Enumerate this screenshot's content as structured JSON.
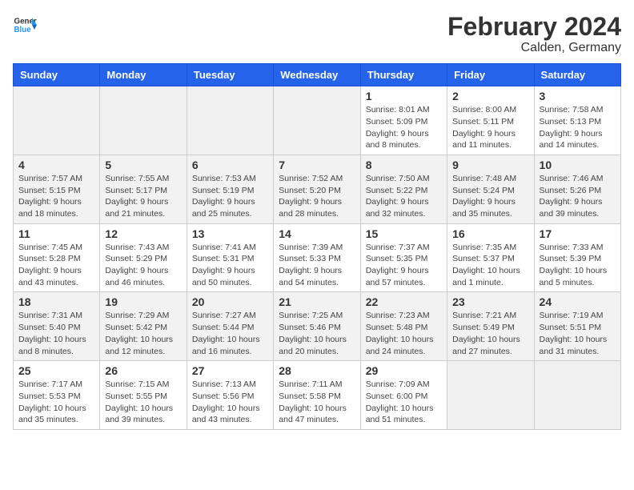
{
  "logo": {
    "general": "General",
    "blue": "Blue"
  },
  "title": "February 2024",
  "subtitle": "Calden, Germany",
  "days_of_week": [
    "Sunday",
    "Monday",
    "Tuesday",
    "Wednesday",
    "Thursday",
    "Friday",
    "Saturday"
  ],
  "weeks": [
    [
      {
        "day": "",
        "info": ""
      },
      {
        "day": "",
        "info": ""
      },
      {
        "day": "",
        "info": ""
      },
      {
        "day": "",
        "info": ""
      },
      {
        "day": "1",
        "info": "Sunrise: 8:01 AM\nSunset: 5:09 PM\nDaylight: 9 hours\nand 8 minutes."
      },
      {
        "day": "2",
        "info": "Sunrise: 8:00 AM\nSunset: 5:11 PM\nDaylight: 9 hours\nand 11 minutes."
      },
      {
        "day": "3",
        "info": "Sunrise: 7:58 AM\nSunset: 5:13 PM\nDaylight: 9 hours\nand 14 minutes."
      }
    ],
    [
      {
        "day": "4",
        "info": "Sunrise: 7:57 AM\nSunset: 5:15 PM\nDaylight: 9 hours\nand 18 minutes."
      },
      {
        "day": "5",
        "info": "Sunrise: 7:55 AM\nSunset: 5:17 PM\nDaylight: 9 hours\nand 21 minutes."
      },
      {
        "day": "6",
        "info": "Sunrise: 7:53 AM\nSunset: 5:19 PM\nDaylight: 9 hours\nand 25 minutes."
      },
      {
        "day": "7",
        "info": "Sunrise: 7:52 AM\nSunset: 5:20 PM\nDaylight: 9 hours\nand 28 minutes."
      },
      {
        "day": "8",
        "info": "Sunrise: 7:50 AM\nSunset: 5:22 PM\nDaylight: 9 hours\nand 32 minutes."
      },
      {
        "day": "9",
        "info": "Sunrise: 7:48 AM\nSunset: 5:24 PM\nDaylight: 9 hours\nand 35 minutes."
      },
      {
        "day": "10",
        "info": "Sunrise: 7:46 AM\nSunset: 5:26 PM\nDaylight: 9 hours\nand 39 minutes."
      }
    ],
    [
      {
        "day": "11",
        "info": "Sunrise: 7:45 AM\nSunset: 5:28 PM\nDaylight: 9 hours\nand 43 minutes."
      },
      {
        "day": "12",
        "info": "Sunrise: 7:43 AM\nSunset: 5:29 PM\nDaylight: 9 hours\nand 46 minutes."
      },
      {
        "day": "13",
        "info": "Sunrise: 7:41 AM\nSunset: 5:31 PM\nDaylight: 9 hours\nand 50 minutes."
      },
      {
        "day": "14",
        "info": "Sunrise: 7:39 AM\nSunset: 5:33 PM\nDaylight: 9 hours\nand 54 minutes."
      },
      {
        "day": "15",
        "info": "Sunrise: 7:37 AM\nSunset: 5:35 PM\nDaylight: 9 hours\nand 57 minutes."
      },
      {
        "day": "16",
        "info": "Sunrise: 7:35 AM\nSunset: 5:37 PM\nDaylight: 10 hours\nand 1 minute."
      },
      {
        "day": "17",
        "info": "Sunrise: 7:33 AM\nSunset: 5:39 PM\nDaylight: 10 hours\nand 5 minutes."
      }
    ],
    [
      {
        "day": "18",
        "info": "Sunrise: 7:31 AM\nSunset: 5:40 PM\nDaylight: 10 hours\nand 8 minutes."
      },
      {
        "day": "19",
        "info": "Sunrise: 7:29 AM\nSunset: 5:42 PM\nDaylight: 10 hours\nand 12 minutes."
      },
      {
        "day": "20",
        "info": "Sunrise: 7:27 AM\nSunset: 5:44 PM\nDaylight: 10 hours\nand 16 minutes."
      },
      {
        "day": "21",
        "info": "Sunrise: 7:25 AM\nSunset: 5:46 PM\nDaylight: 10 hours\nand 20 minutes."
      },
      {
        "day": "22",
        "info": "Sunrise: 7:23 AM\nSunset: 5:48 PM\nDaylight: 10 hours\nand 24 minutes."
      },
      {
        "day": "23",
        "info": "Sunrise: 7:21 AM\nSunset: 5:49 PM\nDaylight: 10 hours\nand 27 minutes."
      },
      {
        "day": "24",
        "info": "Sunrise: 7:19 AM\nSunset: 5:51 PM\nDaylight: 10 hours\nand 31 minutes."
      }
    ],
    [
      {
        "day": "25",
        "info": "Sunrise: 7:17 AM\nSunset: 5:53 PM\nDaylight: 10 hours\nand 35 minutes."
      },
      {
        "day": "26",
        "info": "Sunrise: 7:15 AM\nSunset: 5:55 PM\nDaylight: 10 hours\nand 39 minutes."
      },
      {
        "day": "27",
        "info": "Sunrise: 7:13 AM\nSunset: 5:56 PM\nDaylight: 10 hours\nand 43 minutes."
      },
      {
        "day": "28",
        "info": "Sunrise: 7:11 AM\nSunset: 5:58 PM\nDaylight: 10 hours\nand 47 minutes."
      },
      {
        "day": "29",
        "info": "Sunrise: 7:09 AM\nSunset: 6:00 PM\nDaylight: 10 hours\nand 51 minutes."
      },
      {
        "day": "",
        "info": ""
      },
      {
        "day": "",
        "info": ""
      }
    ]
  ]
}
